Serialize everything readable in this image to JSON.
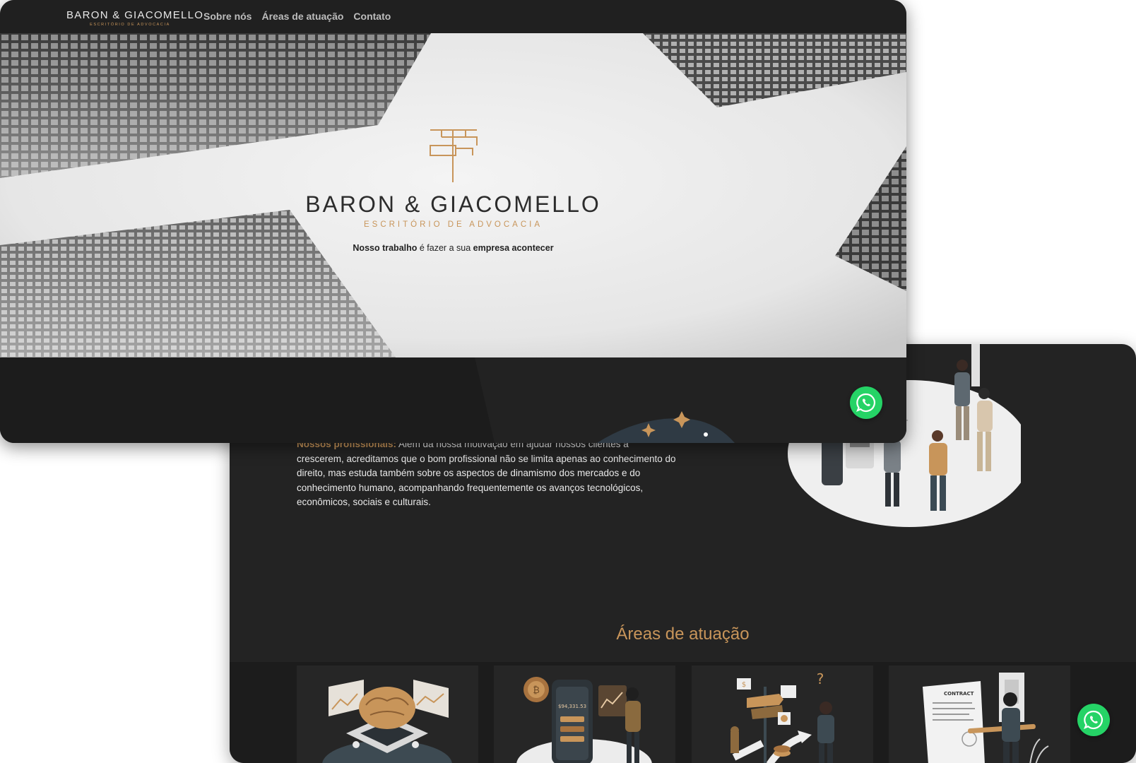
{
  "colors": {
    "accent": "#c8955a",
    "dark_bg": "#232323",
    "whatsapp": "#25d366"
  },
  "front": {
    "nav": {
      "logo_main": "BARON & GIACOMELLO",
      "logo_sub": "ESCRITÓRIO DE ADVOCACIA",
      "links": [
        "Sobre nós",
        "Áreas de atuação",
        "Contato"
      ]
    },
    "hero": {
      "brand": "BARON & GIACOMELLO",
      "subtitle": "ESCRITÓRIO DE ADVOCACIA",
      "tagline_part1": "Nosso trabalho",
      "tagline_part2": " é fazer a sua ",
      "tagline_part3": "empresa acontecer"
    },
    "whatsapp_icon": "whatsapp-icon"
  },
  "back": {
    "about": {
      "highlight": "Nossos profissionais:",
      "body": " Além da nossa motivação em ajudar nossos clientes a crescerem, acreditamos que o bom profissional não se limita apenas ao conhecimento do direito, mas estuda também sobre os aspectos de dinamismo dos mercados e do conhecimento humano, acompanhando frequentemente os avanços tecnológicos, econômicos, sociais e culturais."
    },
    "section_title": "Áreas de atuação",
    "card_illustrations": [
      "brain-analysis-illustration",
      "crypto-finance-illustration",
      "strategy-decision-illustration",
      "contract-signing-illustration"
    ],
    "card_texts": {
      "crypto_balance": "$94,331.53",
      "contract_label": "CONTRACT"
    },
    "whatsapp_icon": "whatsapp-icon"
  }
}
